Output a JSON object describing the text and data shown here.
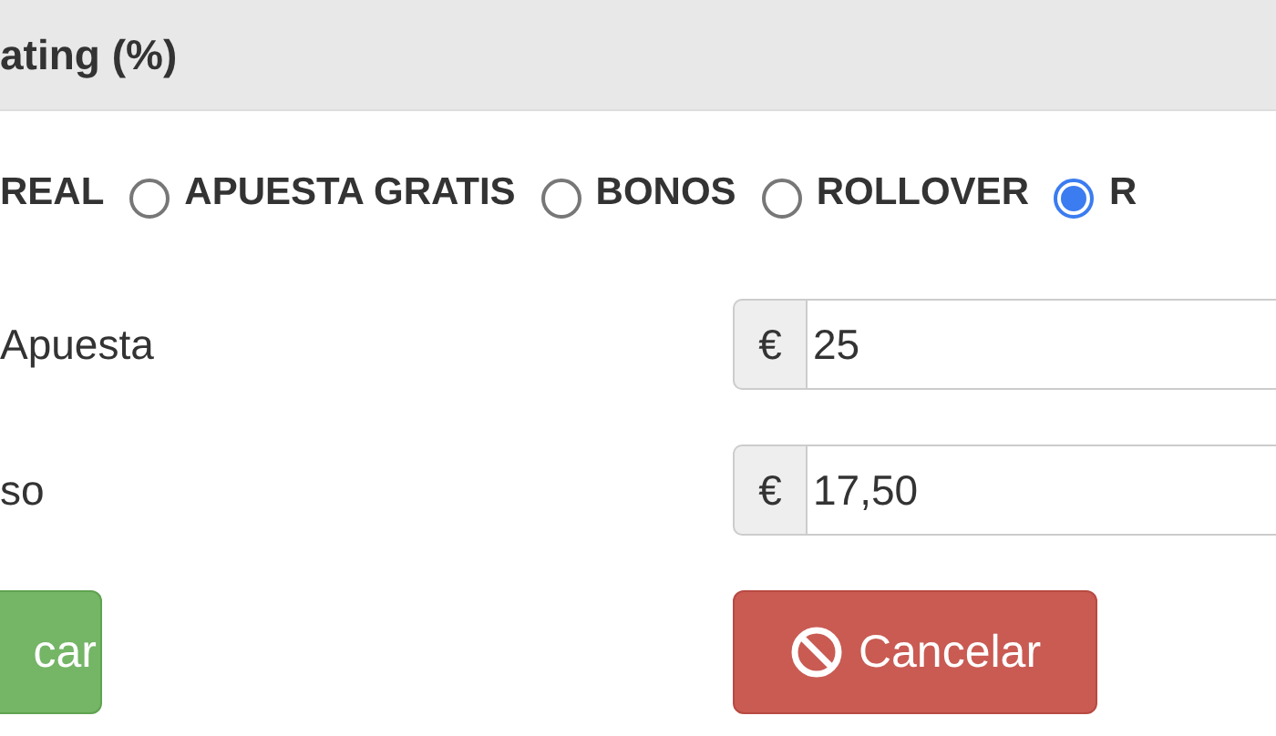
{
  "header": {
    "title": "ating (%)"
  },
  "bet_types": [
    {
      "label": "REAL"
    },
    {
      "label": "APUESTA GRATIS",
      "selected": false
    },
    {
      "label": "BONOS",
      "selected": false
    },
    {
      "label": "ROLLOVER",
      "selected": false
    },
    {
      "label": "R",
      "selected": true
    }
  ],
  "fields": [
    {
      "label": "Apuesta",
      "addon": "€",
      "value": "25"
    },
    {
      "label": "so",
      "addon": "€",
      "value": "17,50"
    }
  ],
  "buttons": [
    {
      "kind": "success",
      "label": "car"
    },
    {
      "kind": "cancel",
      "label": "Cancelar"
    }
  ]
}
